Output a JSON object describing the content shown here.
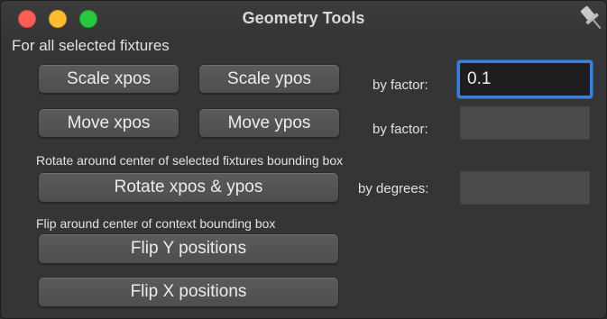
{
  "window": {
    "title": "Geometry Tools"
  },
  "icons": {
    "close": "red-close-icon",
    "minimize": "yellow-minimize-icon",
    "zoom": "green-zoom-icon",
    "pin": "pin-icon"
  },
  "section_selected": {
    "label": "For all selected fixtures",
    "scale_x_label": "Scale xpos",
    "scale_y_label": "Scale ypos",
    "scale_factor_label": "by factor:",
    "scale_factor_value": "0.1",
    "move_x_label": "Move xpos",
    "move_y_label": "Move ypos",
    "move_factor_label": "by factor:",
    "move_factor_value": ""
  },
  "section_rotate": {
    "label": "Rotate around center of selected fixtures bounding box",
    "rotate_label": "Rotate xpos & ypos",
    "degrees_label": "by degrees:",
    "degrees_value": ""
  },
  "section_flip": {
    "label": "Flip around center of context bounding box",
    "flip_y_label": "Flip Y positions",
    "flip_x_label": "Flip X positions"
  },
  "colors": {
    "window_bg": "#353535",
    "button_bg": "#555555",
    "focus_ring": "#3d7fd1",
    "close": "#fd5d57",
    "minimize": "#febc2e",
    "zoom": "#28c840"
  }
}
